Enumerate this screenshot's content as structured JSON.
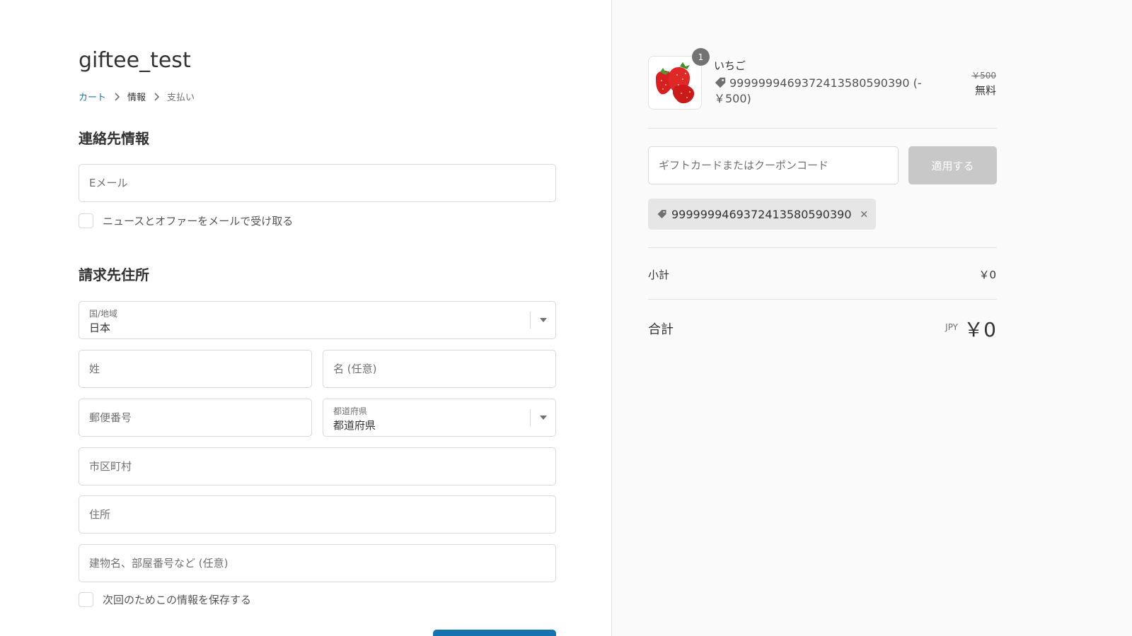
{
  "store": {
    "title": "giftee_test"
  },
  "breadcrumb": {
    "cart": "カート",
    "info": "情報",
    "payment": "支払い"
  },
  "contact": {
    "title": "連絡先情報",
    "email_placeholder": "Eメール",
    "newsletter_label": "ニュースとオファーをメールで受け取る"
  },
  "billing": {
    "title": "請求先住所",
    "country_label": "国/地域",
    "country_value": "日本",
    "last_name_placeholder": "姓",
    "first_name_placeholder": "名 (任意)",
    "postal_placeholder": "郵便番号",
    "prefecture_label": "都道府県",
    "prefecture_value": "都道府県",
    "city_placeholder": "市区町村",
    "address_placeholder": "住所",
    "building_placeholder": "建物名、部屋番号など (任意)",
    "save_info_label": "次回のためこの情報を保存する"
  },
  "order": {
    "quantity": "1",
    "product_name": "いちご",
    "product_discount": "9999999469372413580590390 (-￥500)",
    "price_original": "￥500",
    "price_final": "無料",
    "coupon_placeholder": "ギフトカードまたはクーポンコード",
    "apply_label": "適用する",
    "discount_code": "9999999469372413580590390",
    "subtotal_label": "小計",
    "subtotal_value": "￥0",
    "total_label": "合計",
    "total_currency": "JPY",
    "total_value": "￥0"
  },
  "colors": {
    "accent": "#1773b0",
    "chip_bg": "#e6e6e6",
    "apply_disabled": "#c8c8c8"
  }
}
